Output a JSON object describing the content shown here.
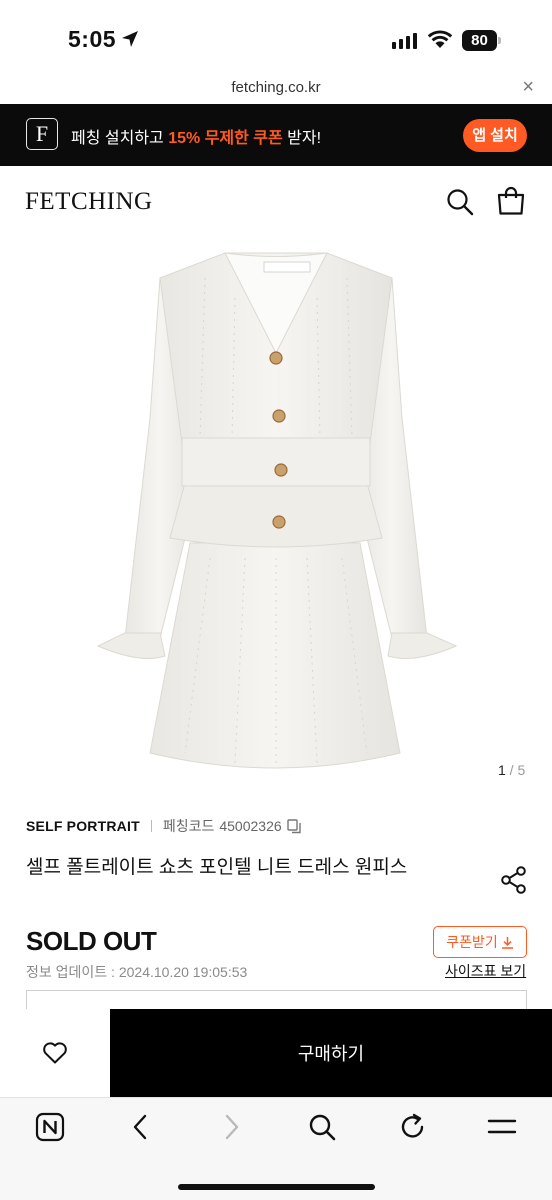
{
  "status_bar": {
    "time": "5:05",
    "battery": "80"
  },
  "browser": {
    "url": "fetching.co.kr",
    "close_label": "×"
  },
  "promo": {
    "logo_letter": "F",
    "text_before": "페칭 설치하고 ",
    "text_highlight": "15% 무제한 쿠폰",
    "text_after": " 받자!",
    "install_label": "앱 설치",
    "accent_color": "#ff5a23"
  },
  "header": {
    "logo": "FETCHING",
    "icons": [
      "search-icon",
      "shopping-bag-icon"
    ]
  },
  "gallery": {
    "current": "1",
    "separator": " / ",
    "total": "5"
  },
  "product": {
    "brand": "SELF PORTRAIT",
    "code_label": "페칭코드",
    "code": "45002326",
    "title": "셀프 폴트레이트 쇼츠 포인텔 니트 드레스 원피스",
    "status": "SOLD OUT",
    "updated": "정보 업데이트 : 2024.10.20 19:05:53",
    "coupon_label": "쿠폰받기",
    "size_guide_label": "사이즈표 보기"
  },
  "purchase": {
    "buy_label": "구매하기"
  },
  "toolbar": {
    "icons": [
      "naver-home-icon",
      "back-arrow-icon",
      "forward-arrow-icon",
      "search-icon",
      "reload-icon",
      "menu-icon"
    ]
  }
}
